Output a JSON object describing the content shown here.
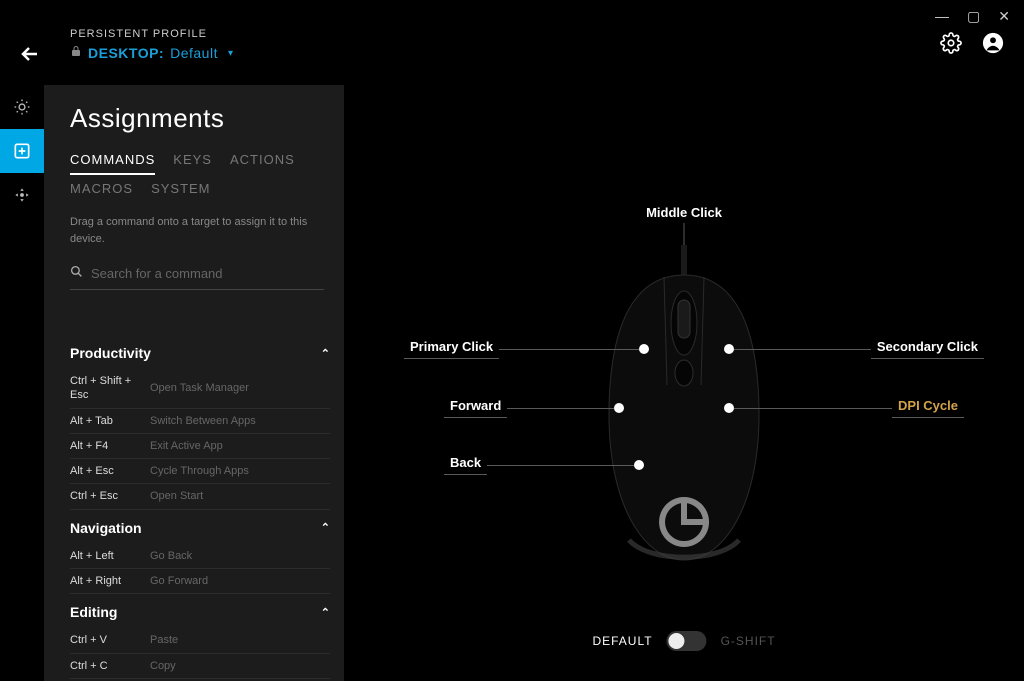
{
  "header": {
    "profile_label": "PERSISTENT PROFILE",
    "device_prefix": "DESKTOP:",
    "profile_name": "Default"
  },
  "sidebar": {
    "title": "Assignments",
    "tabs": [
      "COMMANDS",
      "KEYS",
      "ACTIONS",
      "MACROS",
      "SYSTEM"
    ],
    "active_tab": 0,
    "hint": "Drag a command onto a target to assign it to this device.",
    "search_placeholder": "Search for a command",
    "sections": [
      {
        "name": "Productivity",
        "items": [
          {
            "key": "Ctrl + Shift + Esc",
            "desc": "Open Task Manager"
          },
          {
            "key": "Alt + Tab",
            "desc": "Switch Between Apps"
          },
          {
            "key": "Alt + F4",
            "desc": "Exit Active App"
          },
          {
            "key": "Alt + Esc",
            "desc": "Cycle Through Apps"
          },
          {
            "key": "Ctrl + Esc",
            "desc": "Open Start"
          }
        ]
      },
      {
        "name": "Navigation",
        "items": [
          {
            "key": "Alt + Left",
            "desc": "Go Back"
          },
          {
            "key": "Alt + Right",
            "desc": "Go Forward"
          }
        ]
      },
      {
        "name": "Editing",
        "items": [
          {
            "key": "Ctrl + V",
            "desc": "Paste"
          },
          {
            "key": "Ctrl + C",
            "desc": "Copy"
          }
        ]
      }
    ]
  },
  "mouse": {
    "callouts": {
      "middle": "Middle Click",
      "primary": "Primary Click",
      "forward": "Forward",
      "back": "Back",
      "secondary": "Secondary Click",
      "dpi": "DPI Cycle"
    }
  },
  "toggle": {
    "default": "DEFAULT",
    "gshift": "G-SHIFT"
  }
}
